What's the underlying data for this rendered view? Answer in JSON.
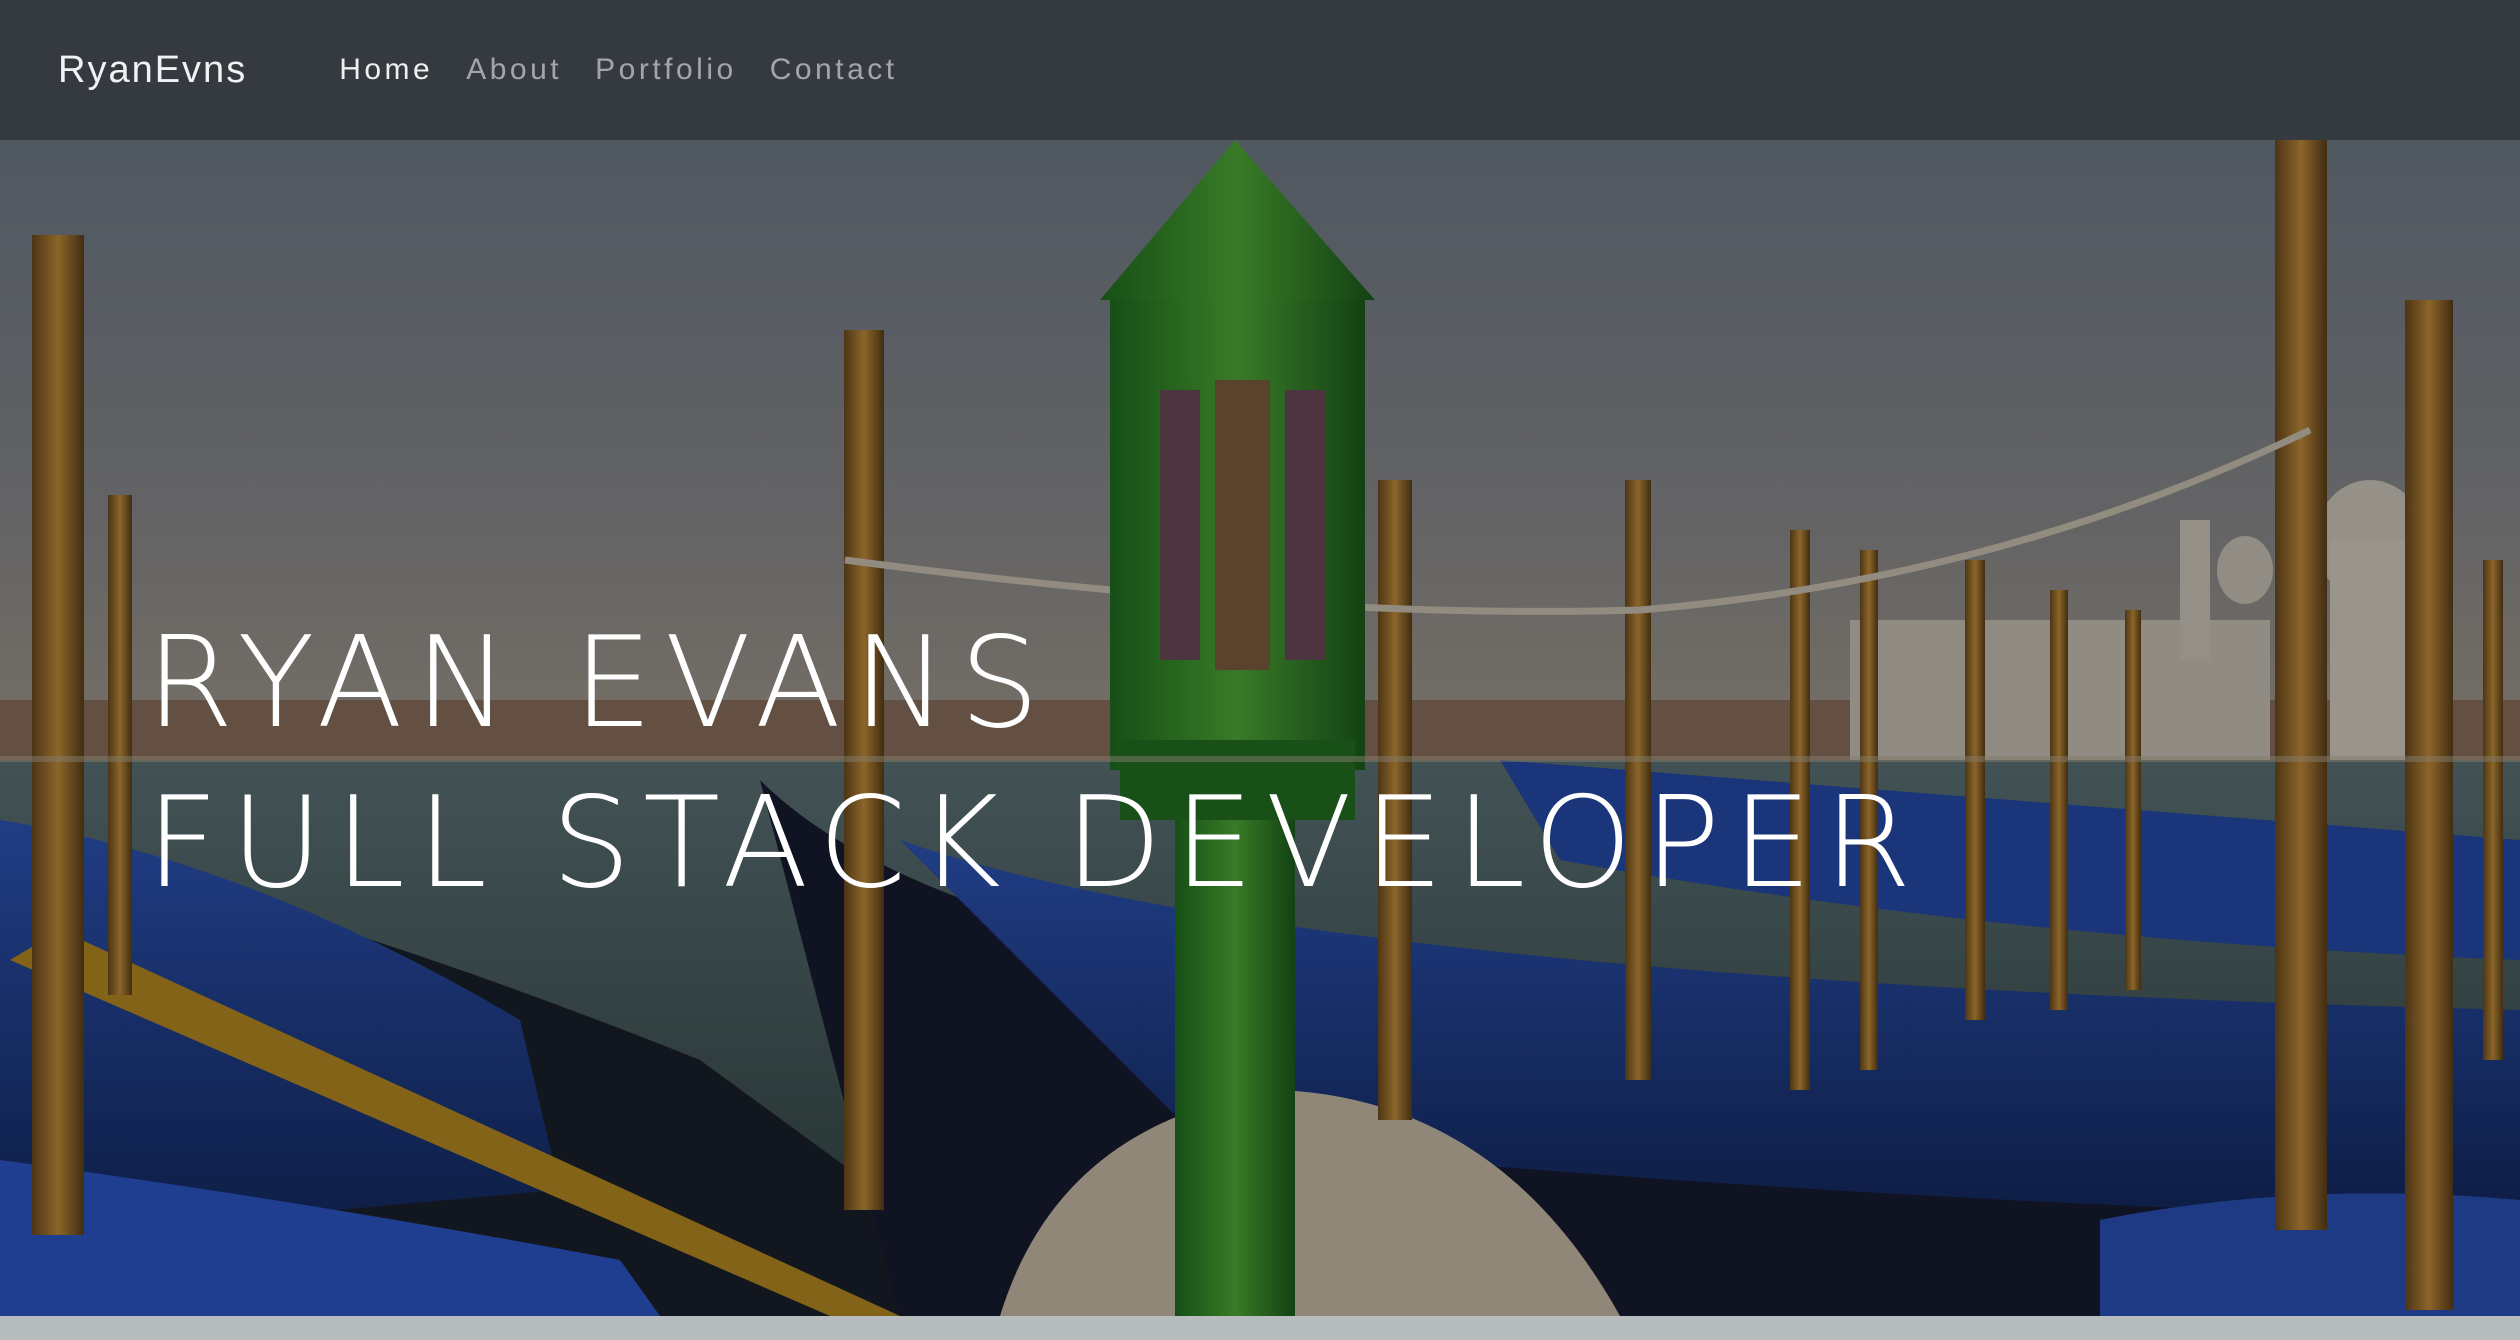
{
  "navbar": {
    "brand": "RyanEvns",
    "links": [
      {
        "label": "Home",
        "active": true
      },
      {
        "label": "About",
        "active": false
      },
      {
        "label": "Portfolio",
        "active": false
      },
      {
        "label": "Contact",
        "active": false
      }
    ]
  },
  "hero": {
    "line1": "RYAN EVANS",
    "line2": "FULL STACK DEVELOPER"
  },
  "colors": {
    "navbar_bg": "#343a40",
    "hero_text": "#ffffff",
    "bottom_strip": "#b7bcbf"
  }
}
